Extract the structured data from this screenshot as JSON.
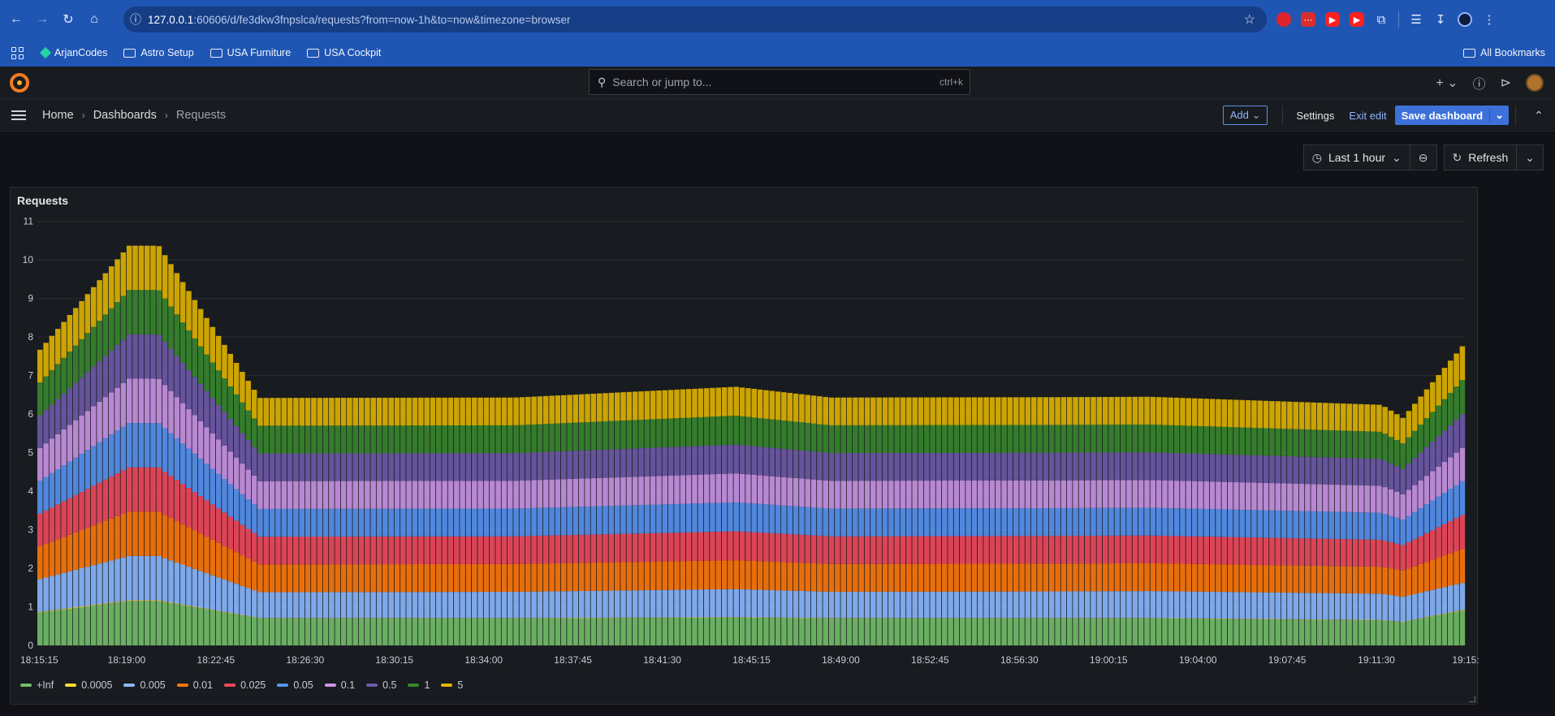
{
  "browser": {
    "url_host": "127.0.0.1",
    "url_rest": ":60606/d/fe3dkw3fnpslca/requests?from=now-1h&to=now&timezone=browser",
    "bookmarks": [
      "ArjanCodes",
      "Astro Setup",
      "USA Furniture",
      "USA Cockpit"
    ],
    "all_bookmarks": "All Bookmarks"
  },
  "grafana": {
    "search_placeholder": "Search or jump to...",
    "search_shortcut": "ctrl+k",
    "breadcrumb": [
      "Home",
      "Dashboards",
      "Requests"
    ],
    "add_label": "Add",
    "settings_label": "Settings",
    "exit_edit_label": "Exit edit",
    "save_label": "Save dashboard",
    "time_range": "Last 1 hour",
    "refresh_label": "Refresh"
  },
  "panel": {
    "title": "Requests"
  },
  "chart_data": {
    "type": "bar",
    "stacked": true,
    "title": "Requests",
    "ylim": [
      0,
      11.5
    ],
    "yticks": [
      0,
      1,
      2,
      3,
      4,
      5,
      6,
      7,
      8,
      9,
      10,
      11
    ],
    "xticks": [
      "18:15:15",
      "18:19:00",
      "18:22:45",
      "18:26:30",
      "18:30:15",
      "18:34:00",
      "18:37:45",
      "18:41:30",
      "18:45:15",
      "18:49:00",
      "18:52:45",
      "18:56:30",
      "19:00:15",
      "19:04:00",
      "19:07:45",
      "19:11:30",
      "19:15:"
    ],
    "grid": true,
    "legend_position": "bottom-left",
    "x_layer_keypoints_minutes": [
      0,
      3.75,
      5,
      9.25,
      20,
      29.3,
      33.3,
      42.75,
      46.75,
      56.5,
      57.4,
      59.9
    ],
    "series": [
      {
        "name": "+Inf",
        "color": "#73bf69",
        "values": [
          0.85,
          1.15,
          1.15,
          0.7,
          0.7,
          0.72,
          0.7,
          0.7,
          0.7,
          0.65,
          0.6,
          0.9
        ]
      },
      {
        "name": "0.0005",
        "color": "#fade2a",
        "values": [
          0.02,
          0.02,
          0.02,
          0.01,
          0.01,
          0.01,
          0.01,
          0.01,
          0.01,
          0.01,
          0.01,
          0.02
        ]
      },
      {
        "name": "0.005",
        "color": "#8ab8ff",
        "values": [
          0.85,
          1.15,
          1.15,
          0.67,
          0.68,
          0.73,
          0.68,
          0.69,
          0.7,
          0.68,
          0.65,
          0.7
        ]
      },
      {
        "name": "0.01",
        "color": "#ff780a",
        "values": [
          0.85,
          1.15,
          1.15,
          0.72,
          0.72,
          0.75,
          0.72,
          0.72,
          0.72,
          0.7,
          0.68,
          0.88
        ]
      },
      {
        "name": "0.025",
        "color": "#f2495c",
        "values": [
          0.85,
          1.15,
          1.15,
          0.72,
          0.72,
          0.75,
          0.72,
          0.72,
          0.72,
          0.7,
          0.66,
          0.88
        ]
      },
      {
        "name": "0.05",
        "color": "#5794f2",
        "values": [
          0.85,
          1.15,
          1.15,
          0.72,
          0.72,
          0.75,
          0.72,
          0.72,
          0.72,
          0.7,
          0.66,
          0.88
        ]
      },
      {
        "name": "0.1",
        "color": "#ca95e5",
        "values": [
          0.85,
          1.15,
          1.15,
          0.72,
          0.72,
          0.75,
          0.72,
          0.72,
          0.72,
          0.7,
          0.66,
          0.86
        ]
      },
      {
        "name": "0.5",
        "color": "#6e5aa8",
        "values": [
          0.85,
          1.15,
          1.15,
          0.72,
          0.72,
          0.75,
          0.72,
          0.72,
          0.72,
          0.7,
          0.66,
          0.88
        ]
      },
      {
        "name": "1",
        "color": "#37872d",
        "values": [
          0.85,
          1.15,
          1.15,
          0.72,
          0.72,
          0.75,
          0.72,
          0.72,
          0.72,
          0.7,
          0.66,
          0.88
        ]
      },
      {
        "name": "5",
        "color": "#e0b400",
        "values": [
          0.85,
          1.15,
          1.15,
          0.72,
          0.72,
          0.75,
          0.72,
          0.72,
          0.72,
          0.7,
          0.66,
          0.88
        ]
      }
    ]
  }
}
